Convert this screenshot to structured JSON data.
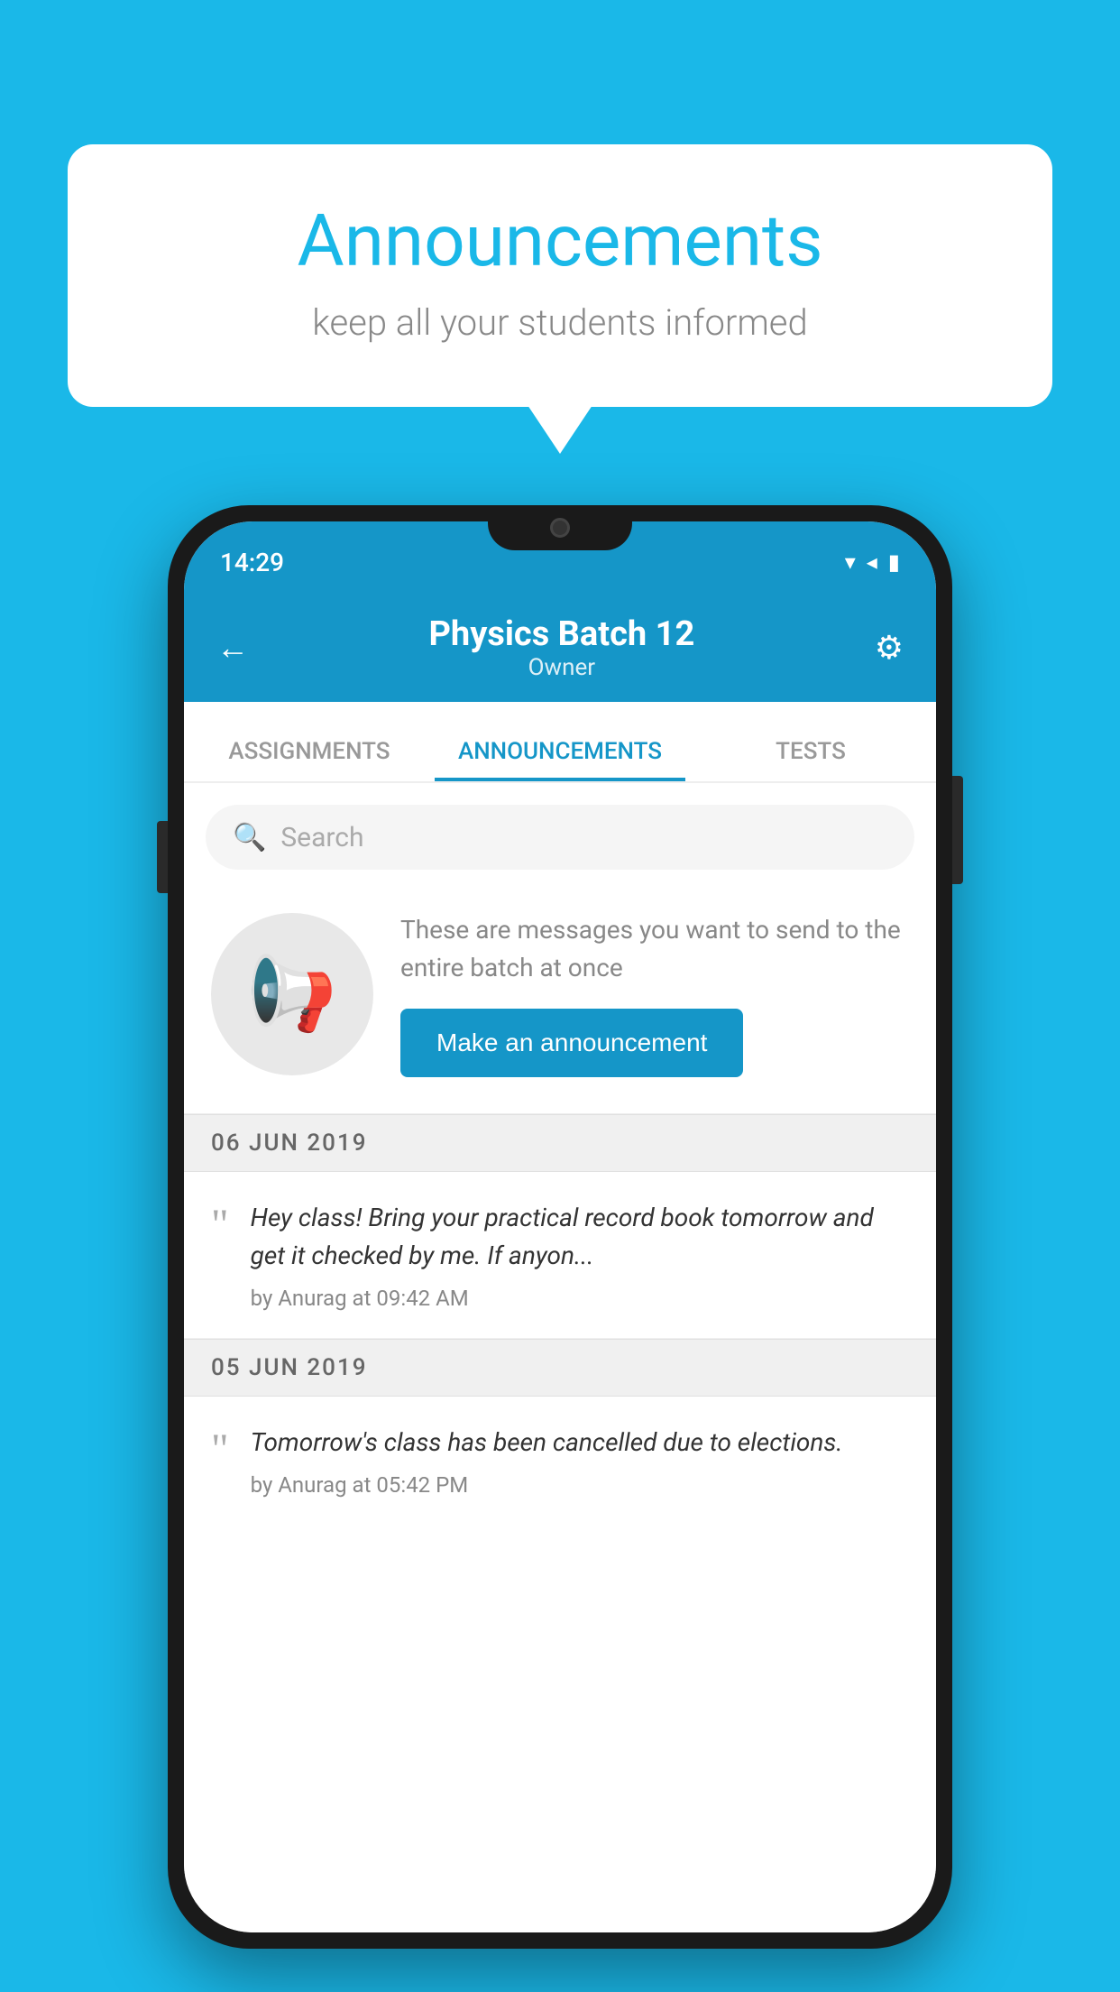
{
  "page": {
    "background_color": "#1ab8e8"
  },
  "speech_bubble": {
    "title": "Announcements",
    "subtitle": "keep all your students informed"
  },
  "status_bar": {
    "time": "14:29",
    "wifi": "▾",
    "signal": "▾",
    "battery": "▾"
  },
  "header": {
    "title": "Physics Batch 12",
    "subtitle": "Owner",
    "back_label": "←",
    "gear_label": "⚙"
  },
  "tabs": [
    {
      "id": "assignments",
      "label": "ASSIGNMENTS",
      "active": false
    },
    {
      "id": "announcements",
      "label": "ANNOUNCEMENTS",
      "active": true
    },
    {
      "id": "tests",
      "label": "TESTS",
      "active": false
    }
  ],
  "search": {
    "placeholder": "Search"
  },
  "announcement_prompt": {
    "description": "These are messages you want to send to the entire batch at once",
    "button_label": "Make an announcement"
  },
  "dates": [
    {
      "label": "06  JUN  2019",
      "messages": [
        {
          "text": "Hey class! Bring your practical record book tomorrow and get it checked by me. If anyon...",
          "meta": "by Anurag at 09:42 AM"
        }
      ]
    },
    {
      "label": "05  JUN  2019",
      "messages": [
        {
          "text": "Tomorrow's class has been cancelled due to elections.",
          "meta": "by Anurag at 05:42 PM"
        }
      ]
    }
  ]
}
